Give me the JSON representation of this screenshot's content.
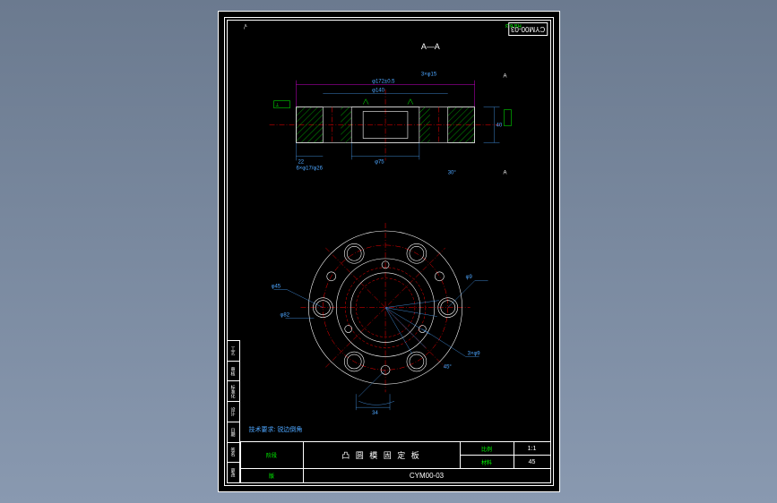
{
  "sheet_code": "CYM00-03",
  "sheet_code_top": "CYM00-03",
  "top_left_mark": "√",
  "drawing_title": "凸 圆 模 固 定 板",
  "section_label": "A—A",
  "scale_label": "比例",
  "scale_value": "1:1",
  "material_label": "材料",
  "material_value": "45",
  "stage_label": "阶段",
  "rev_label": "版",
  "notes": {
    "ra": "Ra 6.3",
    "tech": "技术要求: 锐边倒角"
  },
  "dimensions": {
    "d1": "φ45",
    "d2": "3×φ15",
    "d3": "φ75",
    "d4": "φ9",
    "d5": "3×φ9",
    "d6": "φ172±0.5",
    "d7": "φ140",
    "d8": "40",
    "d9": "22",
    "d10": "6×φ17/φ26",
    "d11": "φ82",
    "d12": "30°",
    "d13": "45°",
    "d14": "34"
  },
  "left_labels": [
    "工艺",
    "审核",
    "标准化",
    "设计",
    "日期",
    "签名",
    "更改"
  ],
  "chart_data": {
    "type": "engineering-drawing",
    "views": [
      {
        "name": "section-A-A",
        "y": 0,
        "components": [
          "flange_profile",
          "holes",
          "hatching",
          "dimensions"
        ]
      },
      {
        "name": "plan",
        "y": 1,
        "components": [
          "outer_circle",
          "bolt_circle",
          "inner_bore",
          "holes_pattern",
          "angular_dims"
        ]
      }
    ],
    "flange": {
      "outer_dia": 172,
      "hub_dia": 140,
      "bore_dia": 75,
      "thickness": 40,
      "step": 22,
      "bolt_holes": {
        "count": 6,
        "dia": 17,
        "cb_dia": 26,
        "bcd": 140
      },
      "small_holes": {
        "count": 3,
        "dia": 9
      },
      "aux_holes": {
        "count": 3,
        "dia": 15
      },
      "angles": [
        30,
        45
      ]
    }
  }
}
